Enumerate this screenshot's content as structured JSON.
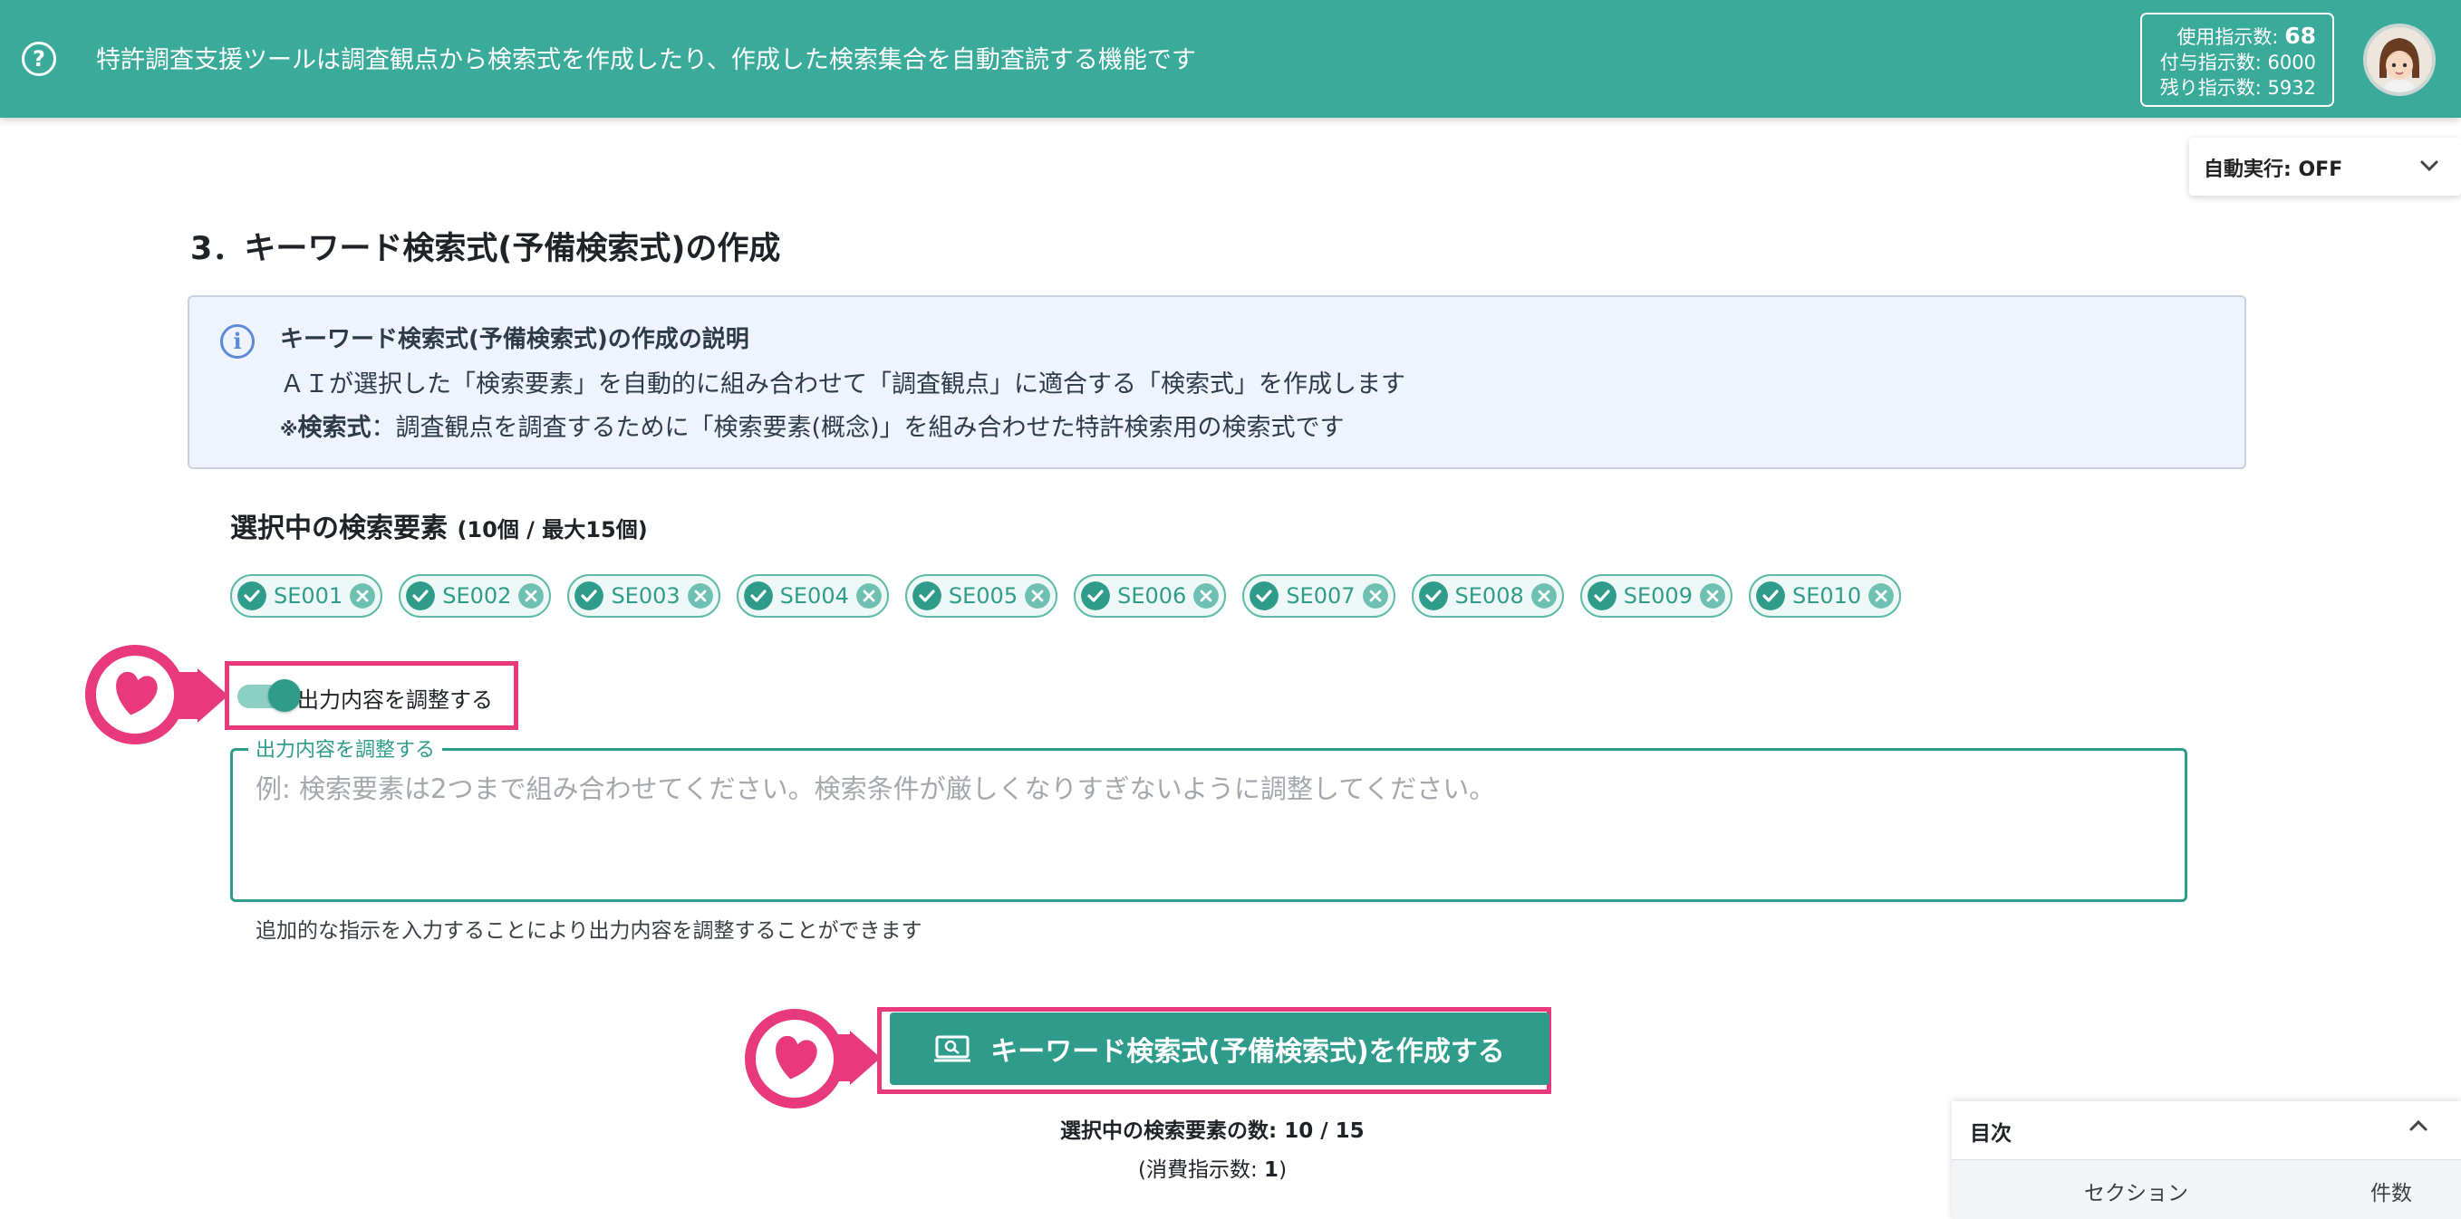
{
  "header": {
    "help_icon": "question-circle-icon",
    "description": "特許調査支援ツールは調査観点から検索式を作成したり、作成した検索集合を自動査読する機能です",
    "usage": {
      "used_label": "使用指示数:",
      "used_value": "68",
      "granted_label": "付与指示数:",
      "granted_value": "6000",
      "remaining_label": "残り指示数:",
      "remaining_value": "5932"
    },
    "avatar_icon": "user-avatar-icon"
  },
  "autorun": {
    "label": "自動実行: OFF",
    "icon": "chevron-down-icon"
  },
  "section": {
    "title": "3．キーワード検索式(予備検索式)の作成"
  },
  "info": {
    "icon": "info-circle-icon",
    "title": "キーワード検索式(予備検索式)の作成の説明",
    "line1": "ＡＩが選択した「検索要素」を自動的に組み合わせて「調査観点」に適合する「検索式」を作成します",
    "line2_mark": "※",
    "line2_term": "検索式",
    "line2_text": "：調査観点を調査するために「検索要素(概念)」を組み合わせた特許検索用の検索式です"
  },
  "selected": {
    "heading": "選択中の検索要素",
    "count_note": "(10個 / 最大15個)",
    "chips": [
      "SE001",
      "SE002",
      "SE003",
      "SE004",
      "SE005",
      "SE006",
      "SE007",
      "SE008",
      "SE009",
      "SE010"
    ]
  },
  "adjust": {
    "toggle_label": "出力内容を調整する",
    "toggle_on": true,
    "field_legend": "出力内容を調整する",
    "placeholder": "例: 検索要素は2つまで組み合わせてください。検索条件が厳しくなりすぎないように調整してください。",
    "help_text": "追加的な指示を入力することにより出力内容を調整することができます"
  },
  "create": {
    "button_label": "キーワード検索式(予備検索式)を作成する",
    "icon": "search-monitor-icon",
    "count_label": "選択中の検索要素の数: 10 / 15",
    "consume_prefix": "(消費指示数: ",
    "consume_value": "1",
    "consume_suffix": ")"
  },
  "toc": {
    "title": "目次",
    "icon": "chevron-up-icon",
    "col_section": "セクション",
    "col_count": "件数"
  },
  "colors": {
    "primary": "#3aab9b",
    "primary_dark": "#2f9c8b",
    "highlight": "#e8397d",
    "info_bg": "#eef3fd"
  }
}
